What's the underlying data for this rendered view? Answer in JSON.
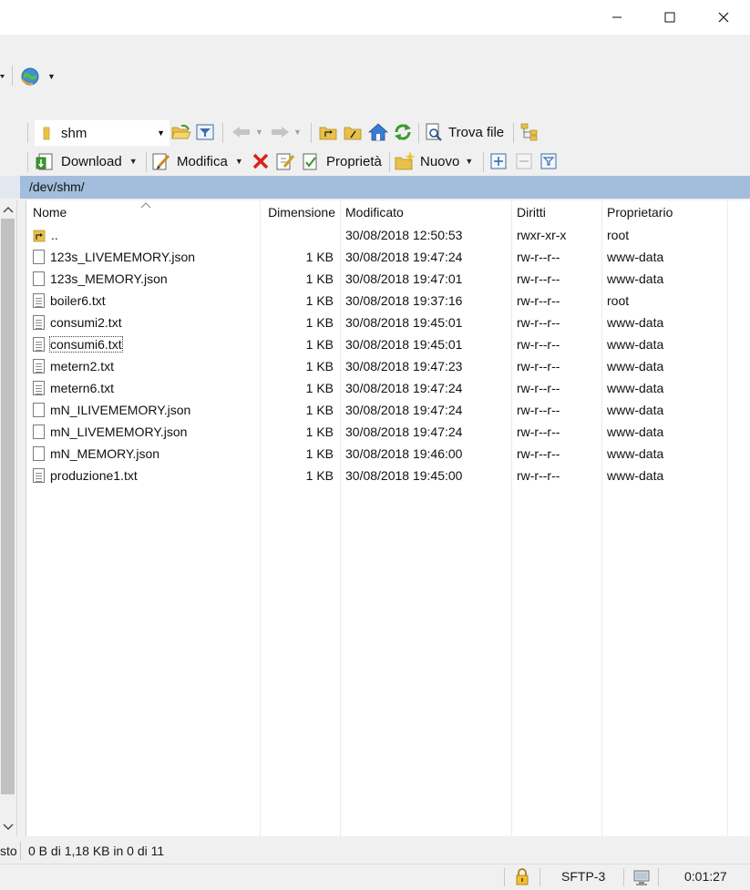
{
  "window": {
    "minimize": "—",
    "maximize": "☐",
    "close": "✕"
  },
  "toolbar1": {
    "folder_name": "shm",
    "find_files": "Trova file"
  },
  "toolbar2": {
    "download": "Download",
    "edit": "Modifica",
    "properties": "Proprietà",
    "new": "Nuovo"
  },
  "path": "/dev/shm/",
  "columns": {
    "name": "Nome",
    "size": "Dimensione",
    "modified": "Modificato",
    "rights": "Diritti",
    "owner": "Proprietario"
  },
  "files": [
    {
      "name": "..",
      "size": "",
      "modified": "30/08/2018 12:50:53",
      "rights": "rwxr-xr-x",
      "owner": "root",
      "kind": "parent"
    },
    {
      "name": "123s_LIVEMEMORY.json",
      "size": "1 KB",
      "modified": "30/08/2018 19:47:24",
      "rights": "rw-r--r--",
      "owner": "www-data",
      "kind": "file"
    },
    {
      "name": "123s_MEMORY.json",
      "size": "1 KB",
      "modified": "30/08/2018 19:47:01",
      "rights": "rw-r--r--",
      "owner": "www-data",
      "kind": "file"
    },
    {
      "name": "boiler6.txt",
      "size": "1 KB",
      "modified": "30/08/2018 19:37:16",
      "rights": "rw-r--r--",
      "owner": "root",
      "kind": "txt"
    },
    {
      "name": "consumi2.txt",
      "size": "1 KB",
      "modified": "30/08/2018 19:45:01",
      "rights": "rw-r--r--",
      "owner": "www-data",
      "kind": "txt"
    },
    {
      "name": "consumi6.txt",
      "size": "1 KB",
      "modified": "30/08/2018 19:45:01",
      "rights": "rw-r--r--",
      "owner": "www-data",
      "kind": "txt"
    },
    {
      "name": "metern2.txt",
      "size": "1 KB",
      "modified": "30/08/2018 19:47:23",
      "rights": "rw-r--r--",
      "owner": "www-data",
      "kind": "txt"
    },
    {
      "name": "metern6.txt",
      "size": "1 KB",
      "modified": "30/08/2018 19:47:24",
      "rights": "rw-r--r--",
      "owner": "www-data",
      "kind": "txt"
    },
    {
      "name": "mN_ILIVEMEMORY.json",
      "size": "1 KB",
      "modified": "30/08/2018 19:47:24",
      "rights": "rw-r--r--",
      "owner": "www-data",
      "kind": "file"
    },
    {
      "name": "mN_LIVEMEMORY.json",
      "size": "1 KB",
      "modified": "30/08/2018 19:47:24",
      "rights": "rw-r--r--",
      "owner": "www-data",
      "kind": "file"
    },
    {
      "name": "mN_MEMORY.json",
      "size": "1 KB",
      "modified": "30/08/2018 19:46:00",
      "rights": "rw-r--r--",
      "owner": "www-data",
      "kind": "file"
    },
    {
      "name": "produzione1.txt",
      "size": "1 KB",
      "modified": "30/08/2018 19:45:00",
      "rights": "rw-r--r--",
      "owner": "www-data",
      "kind": "txt"
    }
  ],
  "focused_file": "consumi6.txt",
  "status": {
    "left_fragment": "sto",
    "selection": "0 B di 1,18 KB in 0 di 11",
    "protocol": "SFTP-3",
    "elapsed": "0:01:27"
  },
  "icons": {
    "folder": "folder-icon",
    "open_folder": "open-folder-icon",
    "filter": "filter-icon",
    "back": "back-arrow-icon",
    "forward": "forward-arrow-icon",
    "parent_dir": "parent-directory-icon",
    "root_dir": "root-directory-icon",
    "home": "home-icon",
    "refresh": "refresh-icon",
    "find": "find-files-icon",
    "tree": "tree-view-icon",
    "download": "download-icon",
    "edit": "edit-icon",
    "delete": "delete-icon",
    "rename": "rename-icon",
    "properties": "properties-icon",
    "new": "new-icon",
    "select": "select-plus-icon",
    "unselect": "unselect-minus-icon",
    "filter_select": "filter-select-icon",
    "lock": "lock-icon",
    "computer": "computer-icon",
    "globe": "globe-sync-icon"
  },
  "colors": {
    "path_bar": "#a3bedc",
    "accent_green": "#3a9a2c",
    "folder_yellow": "#e8c04a",
    "delete_red": "#d8231c"
  }
}
